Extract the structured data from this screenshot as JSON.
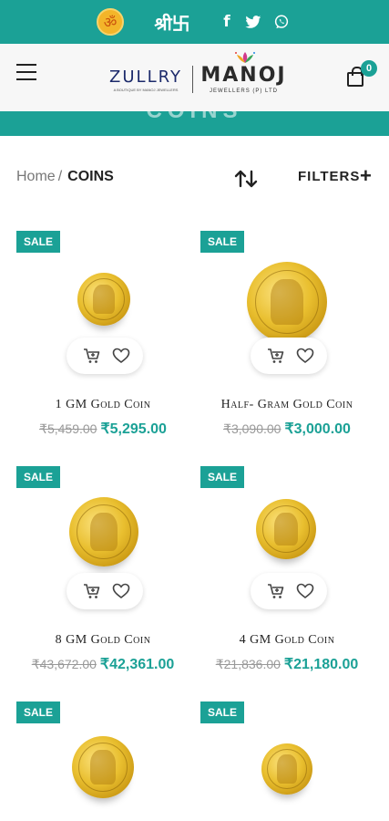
{
  "topbar": {
    "ganesh_glyph": "ॐ",
    "shri_text": "श्री卐",
    "facebook": "f",
    "twitter": "🐦",
    "icons": [
      "ganesh-emblem-icon",
      "facebook-icon",
      "twitter-icon",
      "whatsapp-icon"
    ]
  },
  "header": {
    "logo_left": "ZULLRY",
    "logo_left_sub": "A BOUTIQUE BY MANOJ JEWELLERS",
    "logo_right": "MANOJ",
    "logo_right_sub": "JEWELLERS (P) LTD",
    "cart_count": "0"
  },
  "banner": {
    "title": "COINS"
  },
  "breadcrumb": {
    "home": "Home",
    "separator": "/",
    "current": "COINS"
  },
  "toolbar": {
    "filters_label": "FILTERS",
    "filters_plus": "+"
  },
  "products": [
    {
      "badge": "SALE",
      "name": "1 GM Gold Coin",
      "old_price": "₹5,459.00",
      "new_price": "₹5,295.00"
    },
    {
      "badge": "SALE",
      "name": "Half- Gram Gold Coin",
      "old_price": "₹3,090.00",
      "new_price": "₹3,000.00"
    },
    {
      "badge": "SALE",
      "name": "8 GM Gold Coin",
      "old_price": "₹43,672.00",
      "new_price": "₹42,361.00"
    },
    {
      "badge": "SALE",
      "name": "4 GM Gold Coin",
      "old_price": "₹21,836.00",
      "new_price": "₹21,180.00"
    },
    {
      "badge": "SALE",
      "name": "",
      "old_price": "",
      "new_price": ""
    },
    {
      "badge": "SALE",
      "name": "",
      "old_price": "",
      "new_price": ""
    }
  ],
  "colors": {
    "accent": "#1ba196",
    "header_bg": "#f7f7f7",
    "old_price": "#999999"
  }
}
